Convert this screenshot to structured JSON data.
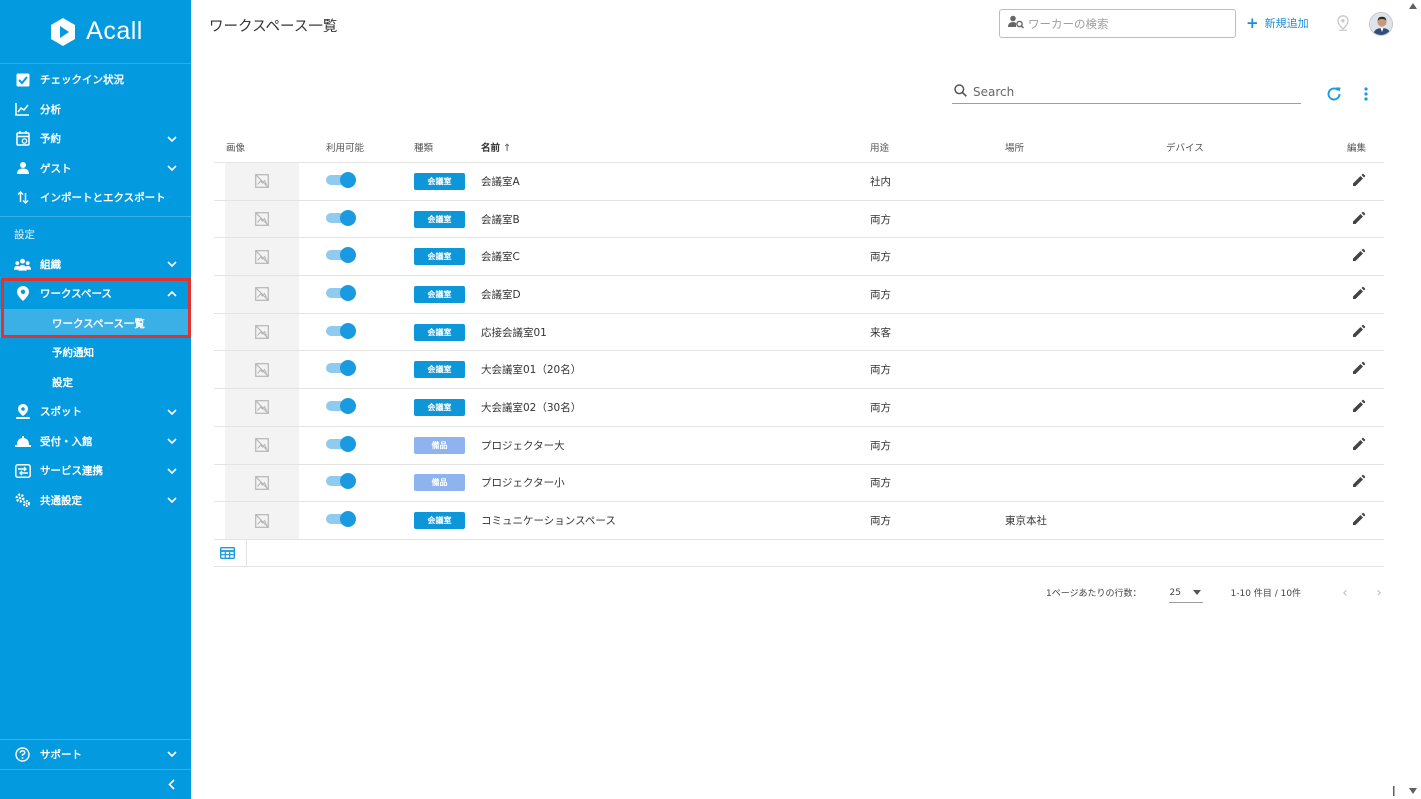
{
  "app": {
    "name": "Acall"
  },
  "colors": {
    "sidebar": "#049ae0",
    "accent": "#1a9ae0",
    "highlight": "#e0332f",
    "badge_meeting": "#0d96d8",
    "badge_equipment": "#8fb3ef"
  },
  "sidebar": {
    "items": [
      {
        "label": "チェックイン状況",
        "icon": "checkbox-icon"
      },
      {
        "label": "分析",
        "icon": "chart-icon"
      },
      {
        "label": "予約",
        "icon": "calendar-icon"
      },
      {
        "label": "ゲスト",
        "icon": "guest-icon"
      },
      {
        "label": "インポートとエクスポート",
        "icon": "import-export-icon"
      }
    ],
    "section_label": "設定",
    "settings_items": [
      {
        "label": "組織",
        "icon": "organization-icon"
      },
      {
        "label": "ワークスペース",
        "icon": "location-pin-icon"
      }
    ],
    "workspace_sub": [
      {
        "label": "ワークスペース一覧"
      },
      {
        "label": "予約通知"
      },
      {
        "label": "設定"
      }
    ],
    "more_items": [
      {
        "label": "スポット",
        "icon": "spot-icon"
      },
      {
        "label": "受付・入館",
        "icon": "reception-icon"
      },
      {
        "label": "サービス連携",
        "icon": "service-link-icon"
      },
      {
        "label": "共通設定",
        "icon": "common-settings-icon"
      }
    ],
    "support_label": "サポート"
  },
  "header": {
    "title": "ワークスペース一覧",
    "worker_search_placeholder": "ワーカーの検索",
    "new_button_label": "新規追加"
  },
  "toolbar": {
    "search_placeholder": "Search"
  },
  "table": {
    "columns": {
      "image": "画像",
      "available": "利用可能",
      "type": "種類",
      "name": "名前",
      "use": "用途",
      "place": "場所",
      "device": "デバイス",
      "edit": "編集"
    },
    "sort_arrow": "↑",
    "rows": [
      {
        "available": true,
        "type": "会議室",
        "type_kind": "meeting",
        "name": "会議室A",
        "use": "社内",
        "place": "",
        "device": ""
      },
      {
        "available": true,
        "type": "会議室",
        "type_kind": "meeting",
        "name": "会議室B",
        "use": "両方",
        "place": "",
        "device": ""
      },
      {
        "available": true,
        "type": "会議室",
        "type_kind": "meeting",
        "name": "会議室C",
        "use": "両方",
        "place": "",
        "device": ""
      },
      {
        "available": true,
        "type": "会議室",
        "type_kind": "meeting",
        "name": "会議室D",
        "use": "両方",
        "place": "",
        "device": ""
      },
      {
        "available": true,
        "type": "会議室",
        "type_kind": "meeting",
        "name": "応接会議室01",
        "use": "来客",
        "place": "",
        "device": ""
      },
      {
        "available": true,
        "type": "会議室",
        "type_kind": "meeting",
        "name": "大会議室01（20名）",
        "use": "両方",
        "place": "",
        "device": ""
      },
      {
        "available": true,
        "type": "会議室",
        "type_kind": "meeting",
        "name": "大会議室02（30名）",
        "use": "両方",
        "place": "",
        "device": ""
      },
      {
        "available": true,
        "type": "備品",
        "type_kind": "equipment",
        "name": "プロジェクター大",
        "use": "両方",
        "place": "",
        "device": ""
      },
      {
        "available": true,
        "type": "備品",
        "type_kind": "equipment",
        "name": "プロジェクター小",
        "use": "両方",
        "place": "",
        "device": ""
      },
      {
        "available": true,
        "type": "会議室",
        "type_kind": "meeting",
        "name": "コミュニケーションスペース",
        "use": "両方",
        "place": "東京本社",
        "device": ""
      }
    ]
  },
  "pagination": {
    "rows_per_page_label": "1ページあたりの行数：",
    "rows_per_page_value": "25",
    "range_text": "1-10 件目 / 10件",
    "prev": "‹",
    "next": "›"
  }
}
